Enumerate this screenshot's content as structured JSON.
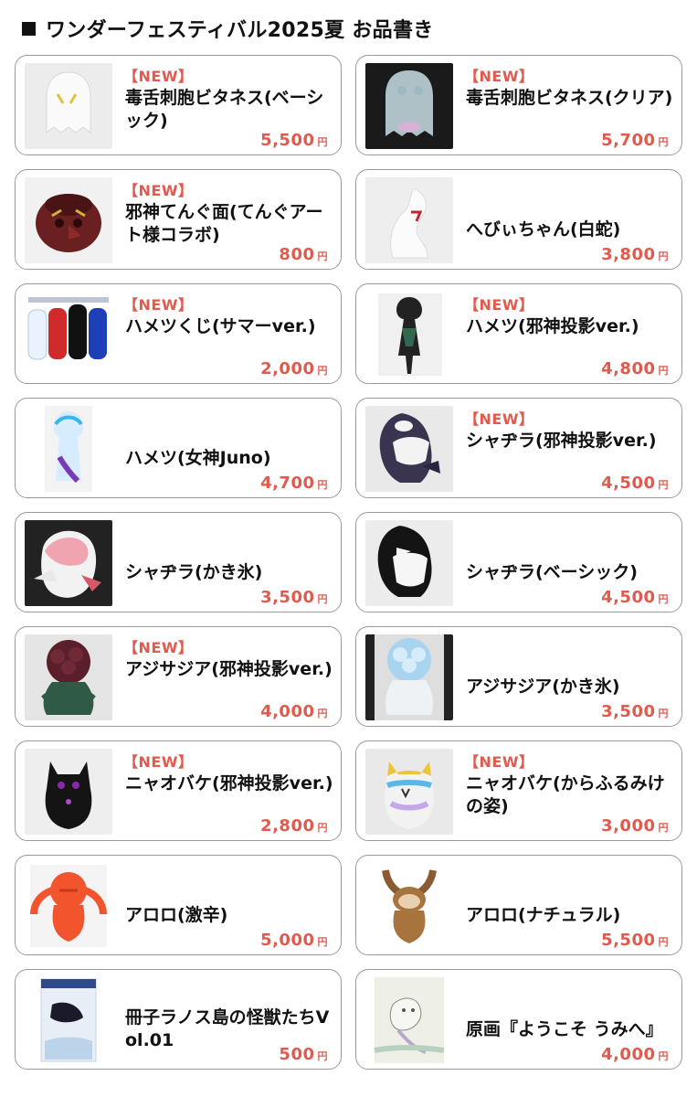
{
  "header": {
    "title": "ワンダーフェスティバル2025夏 お品書き"
  },
  "accent_color": "#e05a4e",
  "currency_unit": "円",
  "items": [
    {
      "badge": "【NEW】",
      "name": "毒舌刺胞ビタネス(ベーシック)",
      "price": "5,500"
    },
    {
      "badge": "【NEW】",
      "name": "毒舌刺胞ビタネス(クリア)",
      "price": "5,700"
    },
    {
      "badge": "【NEW】",
      "name": "邪神てんぐ面(てんぐアート様コラボ)",
      "price": "800"
    },
    {
      "badge": "",
      "name": "へびぃちゃん(白蛇)",
      "price": "3,800"
    },
    {
      "badge": "【NEW】",
      "name": "ハメツくじ(サマーver.)",
      "price": "2,000"
    },
    {
      "badge": "【NEW】",
      "name": "ハメツ(邪神投影ver.)",
      "price": "4,800"
    },
    {
      "badge": "",
      "name": "ハメツ(女神Juno)",
      "price": "4,700"
    },
    {
      "badge": "【NEW】",
      "name": "シャヂラ(邪神投影ver.)",
      "price": "4,500"
    },
    {
      "badge": "",
      "name": "シャヂラ(かき氷)",
      "price": "3,500"
    },
    {
      "badge": "",
      "name": "シャヂラ(ベーシック)",
      "price": "4,500"
    },
    {
      "badge": "【NEW】",
      "name": "アジサジア(邪神投影ver.)",
      "price": "4,000"
    },
    {
      "badge": "",
      "name": "アジサジア(かき氷)",
      "price": "3,500"
    },
    {
      "badge": "【NEW】",
      "name": "ニャオバケ(邪神投影ver.)",
      "price": "2,800"
    },
    {
      "badge": "【NEW】",
      "name": "ニャオバケ(からふるみけの姿)",
      "price": "3,000"
    },
    {
      "badge": "",
      "name": "アロロ(激辛)",
      "price": "5,000"
    },
    {
      "badge": "",
      "name": "アロロ(ナチュラル)",
      "price": "5,500"
    },
    {
      "badge": "",
      "name": "冊子ラノス島の怪獣たちVol.01",
      "price": "500"
    },
    {
      "badge": "",
      "name": "原画『ようこそ うみへ』",
      "price": "4,000"
    }
  ],
  "thumb_icons": [
    "white-ghost-figure-icon",
    "clear-ghost-figure-icon",
    "tengu-mask-icon",
    "white-snake-figure-icon",
    "capsule-toy-figures-icon",
    "dark-figure-icon",
    "blue-purple-figure-icon",
    "orca-figure-icon",
    "pink-whale-figure-icon",
    "orca-basic-figure-icon",
    "dark-hydrangea-figure-icon",
    "blue-hydrangea-figure-icon",
    "black-cat-ghost-icon",
    "rainbow-cat-ghost-icon",
    "red-monster-figure-icon",
    "brown-sloth-figure-icon",
    "booklet-cover-icon",
    "watercolor-painting-icon"
  ]
}
